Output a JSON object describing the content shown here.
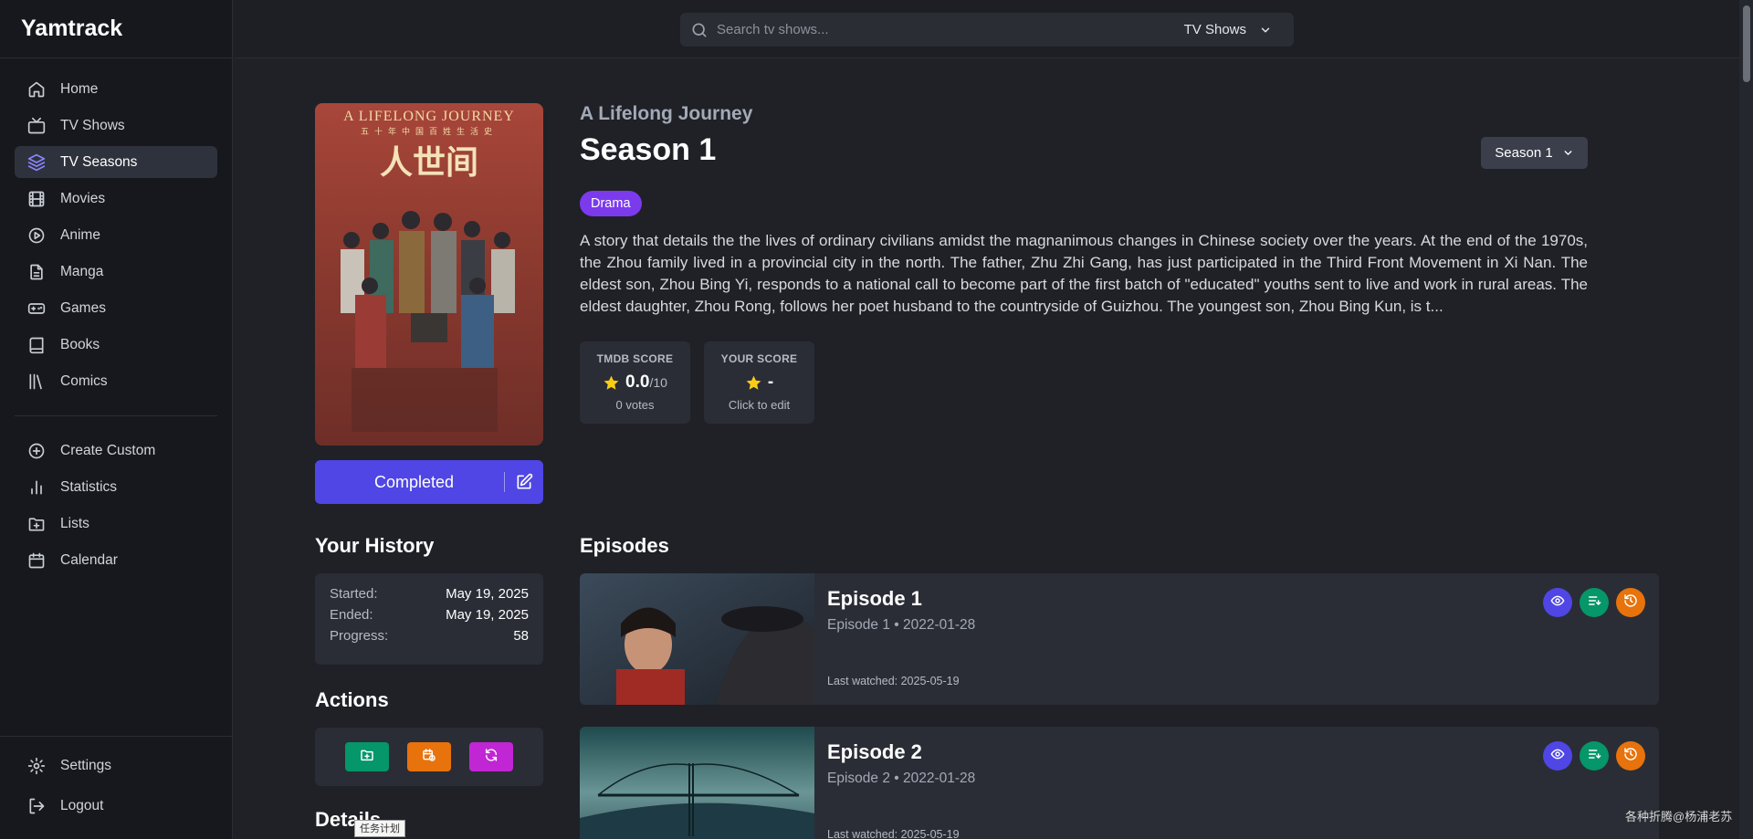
{
  "app": {
    "name": "Yamtrack"
  },
  "sidebar": {
    "items": [
      {
        "label": "Home",
        "icon": "home-icon"
      },
      {
        "label": "TV Shows",
        "icon": "tv-icon"
      },
      {
        "label": "TV Seasons",
        "icon": "layers-icon",
        "active": true
      },
      {
        "label": "Movies",
        "icon": "film-icon"
      },
      {
        "label": "Anime",
        "icon": "play-circle-icon"
      },
      {
        "label": "Manga",
        "icon": "file-icon"
      },
      {
        "label": "Games",
        "icon": "gamepad-icon"
      },
      {
        "label": "Books",
        "icon": "book-icon"
      },
      {
        "label": "Comics",
        "icon": "library-icon"
      }
    ],
    "tools": [
      {
        "label": "Create Custom",
        "icon": "plus-circle-icon"
      },
      {
        "label": "Statistics",
        "icon": "bar-chart-icon"
      },
      {
        "label": "Lists",
        "icon": "folder-plus-icon"
      },
      {
        "label": "Calendar",
        "icon": "calendar-icon"
      }
    ],
    "bottom": [
      {
        "label": "Settings",
        "icon": "gear-icon"
      },
      {
        "label": "Logout",
        "icon": "logout-icon"
      }
    ]
  },
  "search": {
    "placeholder": "Search tv shows...",
    "type_label": "TV Shows"
  },
  "poster": {
    "title_en": "A LIFELONG JOURNEY",
    "subtitle_cn": "五十年中国百姓生活史",
    "title_cn": "人世间"
  },
  "status": {
    "label": "Completed"
  },
  "history": {
    "title": "Your History",
    "rows": [
      {
        "key": "Started:",
        "value": "May 19, 2025"
      },
      {
        "key": "Ended:",
        "value": "May 19, 2025"
      },
      {
        "key": "Progress:",
        "value": "58"
      }
    ]
  },
  "actions": {
    "title": "Actions"
  },
  "details": {
    "title": "Details"
  },
  "tooltip": {
    "text": "任务计划"
  },
  "media": {
    "show_title": "A Lifelong Journey",
    "season_title": "Season 1",
    "season_select": "Season 1",
    "genre": "Drama",
    "overview": "A story that details the the lives of ordinary civilians amidst the magnanimous changes in Chinese society over the years. At the end of the 1970s, the Zhou family lived in a provincial city in the north. The father, Zhu Zhi Gang, has just participated in the Third Front Movement in Xi Nan. The eldest son, Zhou Bing Yi, responds to a national call to become part of the first batch of \"educated\" youths sent to live and work in rural areas. The eldest daughter, Zhou Rong, follows her poet husband to the countryside of Guizhou. The youngest son, Zhou Bing Kun, is t..."
  },
  "scores": {
    "tmdb": {
      "label": "TMDB SCORE",
      "value": "0.0",
      "denominator": "/10",
      "sub": "0 votes"
    },
    "user": {
      "label": "YOUR SCORE",
      "value": "-",
      "sub": "Click to edit"
    }
  },
  "episodes": {
    "title": "Episodes",
    "items": [
      {
        "name": "Episode 1",
        "meta": "Episode 1 • 2022-01-28",
        "last_watched": "Last watched: 2025-05-19"
      },
      {
        "name": "Episode 2",
        "meta": "Episode 2 • 2022-01-28",
        "last_watched": "Last watched: 2025-05-19"
      }
    ]
  },
  "colors": {
    "accent": "#4f46e5",
    "genre": "#7c3aed",
    "watch": "#4f46e5",
    "green": "#059669",
    "orange": "#e8720c",
    "magenta": "#c026d3"
  },
  "watermark": {
    "text": "各种折腾@杨浦老苏"
  }
}
